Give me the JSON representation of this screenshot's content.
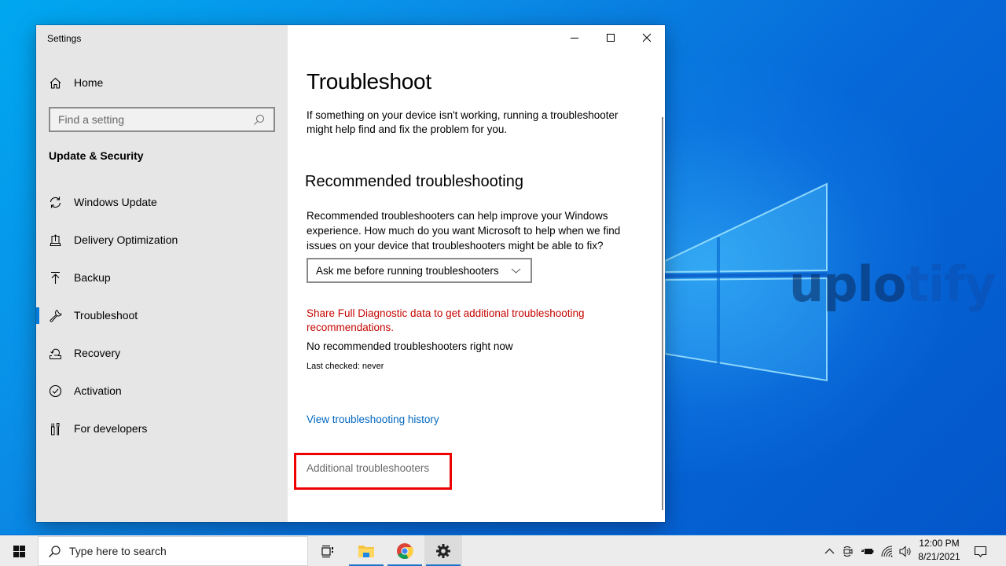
{
  "window": {
    "app_title": "Settings",
    "controls": {
      "minimize": "minimize",
      "maximize": "maximize",
      "close": "close"
    }
  },
  "sidebar": {
    "home_label": "Home",
    "search_placeholder": "Find a setting",
    "section_title": "Update & Security",
    "items": [
      {
        "label": "Windows Update",
        "icon": "sync-icon",
        "active": false
      },
      {
        "label": "Delivery Optimization",
        "icon": "delivery-optimization-icon",
        "active": false
      },
      {
        "label": "Backup",
        "icon": "backup-arrow-icon",
        "active": false
      },
      {
        "label": "Troubleshoot",
        "icon": "wrench-icon",
        "active": true
      },
      {
        "label": "Recovery",
        "icon": "recovery-icon",
        "active": false
      },
      {
        "label": "Activation",
        "icon": "check-circle-icon",
        "active": false
      },
      {
        "label": "For developers",
        "icon": "developer-tools-icon",
        "active": false
      }
    ]
  },
  "content": {
    "title": "Troubleshoot",
    "intro": "If something on your device isn't working, running a troubleshooter might help find and fix the problem for you.",
    "recommended_heading": "Recommended troubleshooting",
    "recommended_desc": "Recommended troubleshooters can help improve your Windows experience. How much do you want Microsoft to help when we find issues on your device that troubleshooters might be able to fix?",
    "dropdown_value": "Ask me before running troubleshooters",
    "diagnostic_link": "Share Full Diagnostic data to get additional troubleshooting recommendations.",
    "no_recommended": "No recommended troubleshooters right now",
    "last_checked": "Last checked: never",
    "history_link": "View troubleshooting history",
    "additional_link": "Additional troubleshooters"
  },
  "desktop": {
    "watermark_strong": "uplo",
    "watermark_faded": "tify"
  },
  "taskbar": {
    "search_placeholder": "Type here to search",
    "pinned": [
      "task-view",
      "file-explorer",
      "chrome",
      "settings"
    ],
    "clock_time": "12:00 PM",
    "clock_date": "8/21/2021"
  },
  "colors": {
    "accent": "#0078d7",
    "link": "#0067c0",
    "warning_link": "#c50500",
    "highlight_box": "#ee0000"
  }
}
